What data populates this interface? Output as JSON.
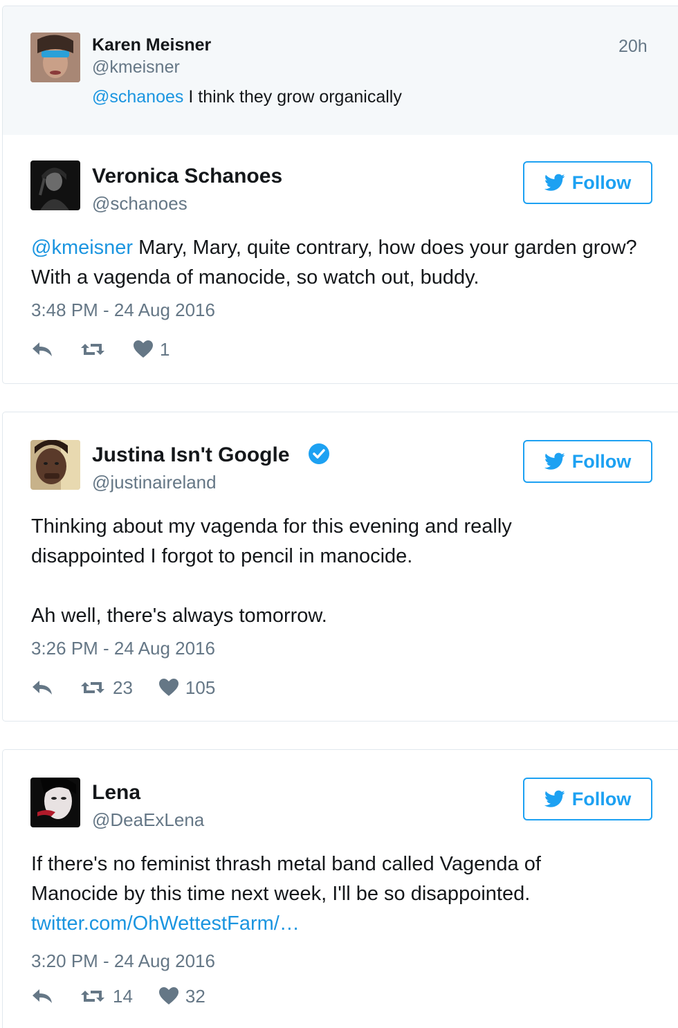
{
  "parent_tweet": {
    "name": "Karen Meisner",
    "handle": "@kmeisner",
    "time_ago": "20h",
    "mention": "@schanoes",
    "text": " I think they grow organically"
  },
  "tweets": [
    {
      "name": "Veronica Schanoes",
      "handle": "@schanoes",
      "follow_label": "Follow",
      "mention": "@kmeisner",
      "text": " Mary, Mary, quite contrary, how does your garden grow? With a vagenda of manocide, so watch out, buddy.",
      "date": "3:48 PM - 24 Aug 2016",
      "retweets": "",
      "likes": "1"
    },
    {
      "name": "Justina Isn't Google",
      "handle": "@justinaireland",
      "verified": true,
      "follow_label": "Follow",
      "text_line1": "Thinking about my vagenda for this evening and really disappointed I forgot to pencil in manocide.",
      "text_line2": "Ah well, there's always tomorrow.",
      "date": "3:26 PM - 24 Aug 2016",
      "retweets": "23",
      "likes": "105"
    },
    {
      "name": "Lena",
      "handle": "@DeaExLena",
      "follow_label": "Follow",
      "text": "If there's no feminist thrash metal band called Vagenda of Manocide by this time next week, I'll be so disappointed.",
      "link": "twitter.com/OhWettestFarm/…",
      "date": "3:20 PM - 24 Aug 2016",
      "retweets": "14",
      "likes": "32"
    }
  ],
  "colors": {
    "accent": "#1da1f2",
    "link": "#1b95e0",
    "muted": "#657786",
    "parent_bg": "#f5f8fa"
  },
  "icons": [
    "reply-icon",
    "retweet-icon",
    "heart-icon",
    "twitter-bird-icon",
    "verified-badge-icon"
  ]
}
